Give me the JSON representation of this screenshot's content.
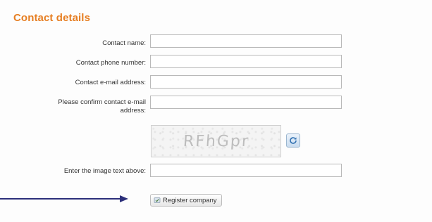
{
  "section": {
    "title": "Contact details"
  },
  "form": {
    "contact_name_label": "Contact name:",
    "contact_phone_label": "Contact phone number:",
    "contact_email_label": "Contact e-mail address:",
    "confirm_email_label_line1": "Please confirm contact e-mail",
    "confirm_email_label_line2": "address:",
    "captcha_text": "RFhGpr",
    "captcha_input_label": "Enter the image text above:",
    "submit_label": "Register company",
    "values": {
      "contact_name": "",
      "contact_phone": "",
      "contact_email": "",
      "confirm_email": "",
      "captcha_input": ""
    }
  },
  "icons": {
    "refresh": "refresh-icon",
    "submit": "register-icon",
    "arrow": "arrow-right-icon"
  },
  "colors": {
    "title": "#e67e22",
    "arrow": "#2c2f7a",
    "field_border": "#b9b9b9"
  }
}
